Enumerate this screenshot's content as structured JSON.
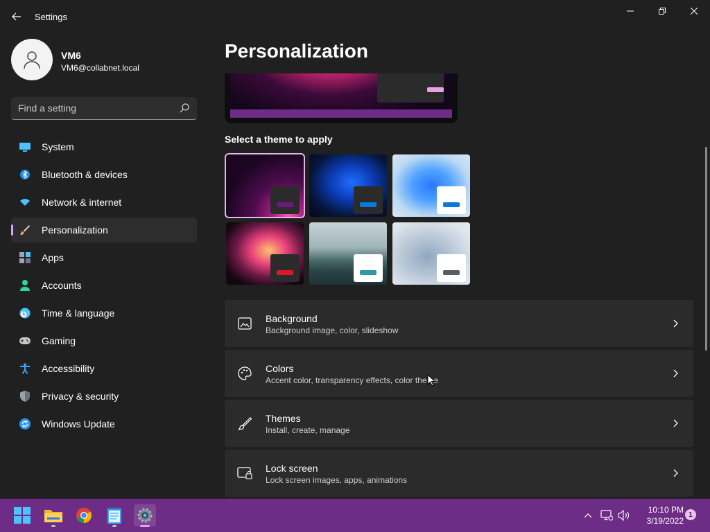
{
  "window": {
    "title": "Settings",
    "icons": {
      "back": "back-arrow-icon",
      "minimize": "minimize-icon",
      "maximize": "restore-icon",
      "close": "close-icon"
    }
  },
  "profile": {
    "name": "VM6",
    "email": "VM6@collabnet.local",
    "avatar_icon": "person-icon"
  },
  "search": {
    "placeholder": "Find a setting",
    "icon": "search-icon"
  },
  "nav": {
    "items": [
      {
        "label": "System",
        "icon": "monitor-icon",
        "color": "#4cc2ff"
      },
      {
        "label": "Bluetooth & devices",
        "icon": "bluetooth-icon",
        "color": "#1b8fe8"
      },
      {
        "label": "Network & internet",
        "icon": "wifi-icon",
        "color": "#4cc2ff"
      },
      {
        "label": "Personalization",
        "icon": "brush-icon",
        "color": "#f0a85a",
        "active": true
      },
      {
        "label": "Apps",
        "icon": "apps-icon",
        "color": "#9aa6b8"
      },
      {
        "label": "Accounts",
        "icon": "person-icon",
        "color": "#2fd6a5"
      },
      {
        "label": "Time & language",
        "icon": "clock-globe-icon",
        "color": "#4cc2ff"
      },
      {
        "label": "Gaming",
        "icon": "gamepad-icon",
        "color": "#c9c9c9"
      },
      {
        "label": "Accessibility",
        "icon": "accessibility-icon",
        "color": "#3aa3ff"
      },
      {
        "label": "Privacy & security",
        "icon": "shield-icon",
        "color": "#9aa0a8"
      },
      {
        "label": "Windows Update",
        "icon": "update-icon",
        "color": "#2f9bf0"
      }
    ]
  },
  "main": {
    "title": "Personalization",
    "themes_label": "Select a theme to apply",
    "themes": [
      {
        "name": "glow-dark",
        "accent": "#6b1a80",
        "mini_bg": "#2b2b2b",
        "selected": true
      },
      {
        "name": "bloom-dark",
        "accent": "#0a7ad8",
        "mini_bg": "#2b2b2b"
      },
      {
        "name": "bloom-light",
        "accent": "#0a7ad8",
        "mini_bg": "#ffffff"
      },
      {
        "name": "captured-motion",
        "accent": "#d7192a",
        "mini_bg": "#2b2b2b"
      },
      {
        "name": "sunrise",
        "accent": "#2f9aa3",
        "mini_bg": "#ffffff"
      },
      {
        "name": "flow",
        "accent": "#555d66",
        "mini_bg": "#ffffff"
      }
    ],
    "cards": [
      {
        "title": "Background",
        "subtitle": "Background image, color, slideshow",
        "icon": "picture-icon"
      },
      {
        "title": "Colors",
        "subtitle": "Accent color, transparency effects, color theme",
        "icon": "palette-icon"
      },
      {
        "title": "Themes",
        "subtitle": "Install, create, manage",
        "icon": "brush-icon"
      },
      {
        "title": "Lock screen",
        "subtitle": "Lock screen images, apps, animations",
        "icon": "lock-screen-icon"
      }
    ]
  },
  "taskbar": {
    "apps": [
      {
        "name": "start-icon"
      },
      {
        "name": "file-explorer-icon"
      },
      {
        "name": "chrome-icon"
      },
      {
        "name": "notepad-icon"
      },
      {
        "name": "settings-icon",
        "active": true
      }
    ],
    "tray": {
      "chevron": "chevron-up-icon",
      "network": "network-icon",
      "volume": "volume-icon"
    },
    "time": "10:10 PM",
    "date": "3/19/2022",
    "notifications": "1"
  },
  "colors": {
    "accent": "#e7a3e4",
    "taskbar": "#6d2d86",
    "background": "#202020",
    "card": "#2b2b2b"
  }
}
